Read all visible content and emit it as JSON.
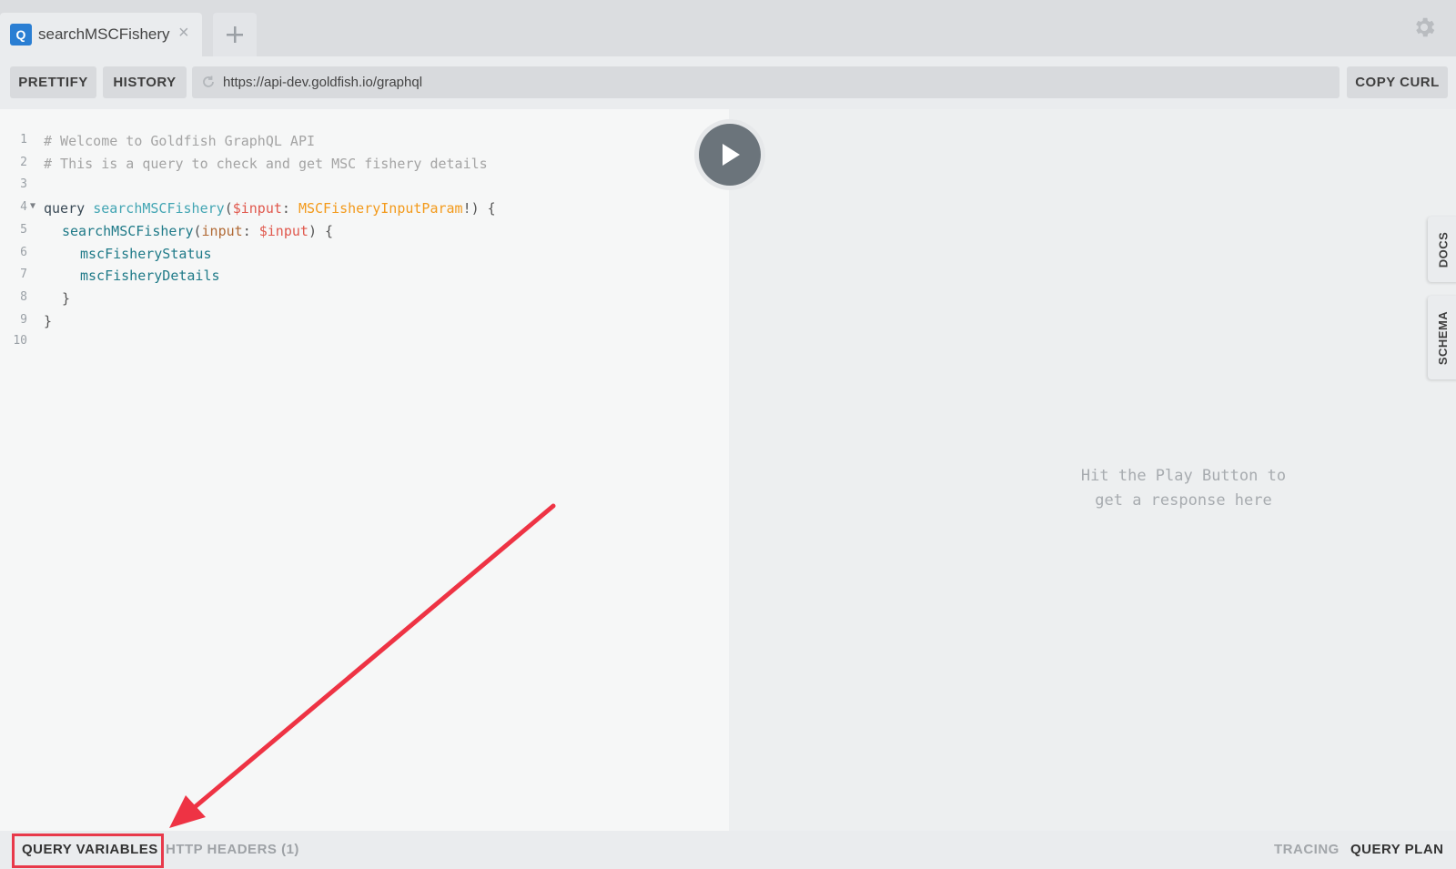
{
  "tabs": [
    {
      "badge": "Q",
      "title": "searchMSCFishery",
      "close": "×"
    }
  ],
  "add_tab_icon": "plus-icon",
  "settings_icon": "gear-icon",
  "toolbar": {
    "prettify": "PRETTIFY",
    "history": "HISTORY",
    "url": "https://api-dev.goldfish.io/graphql",
    "copy_curl": "COPY CURL"
  },
  "editor": {
    "lines": [
      {
        "n": "1"
      },
      {
        "n": "2"
      },
      {
        "n": "3"
      },
      {
        "n": "4"
      },
      {
        "n": "5"
      },
      {
        "n": "6"
      },
      {
        "n": "7"
      },
      {
        "n": "8"
      },
      {
        "n": "9"
      },
      {
        "n": "10"
      }
    ],
    "comment1": "# Welcome to Goldfish GraphQL API",
    "comment2": "# This is a query to check and get MSC fishery details",
    "kw_query": "query",
    "op_name": "searchMSCFishery",
    "paren_open": "(",
    "var_input": "$input",
    "colon": ": ",
    "type_name": "MSCFisheryInputParam",
    "bang_close": "!) {",
    "field_search": "searchMSCFishery",
    "arg_input": "input",
    "arg_colon": ": ",
    "arg_var": "$input",
    "arg_close": ") {",
    "field_status": "mscFisheryStatus",
    "field_details": "mscFisheryDetails",
    "brace_inner": "}",
    "brace_outer": "}"
  },
  "response": {
    "hint_line1": "Hit the Play Button to",
    "hint_line2": "get a response here"
  },
  "side_tabs": {
    "docs": "DOCS",
    "schema": "SCHEMA"
  },
  "bottom": {
    "query_variables": "QUERY VARIABLES",
    "http_headers": "HTTP HEADERS (1)",
    "tracing": "TRACING",
    "query_plan": "QUERY PLAN"
  },
  "colors": {
    "accent": "#2a7ed3",
    "annotation": "#e8394a"
  }
}
